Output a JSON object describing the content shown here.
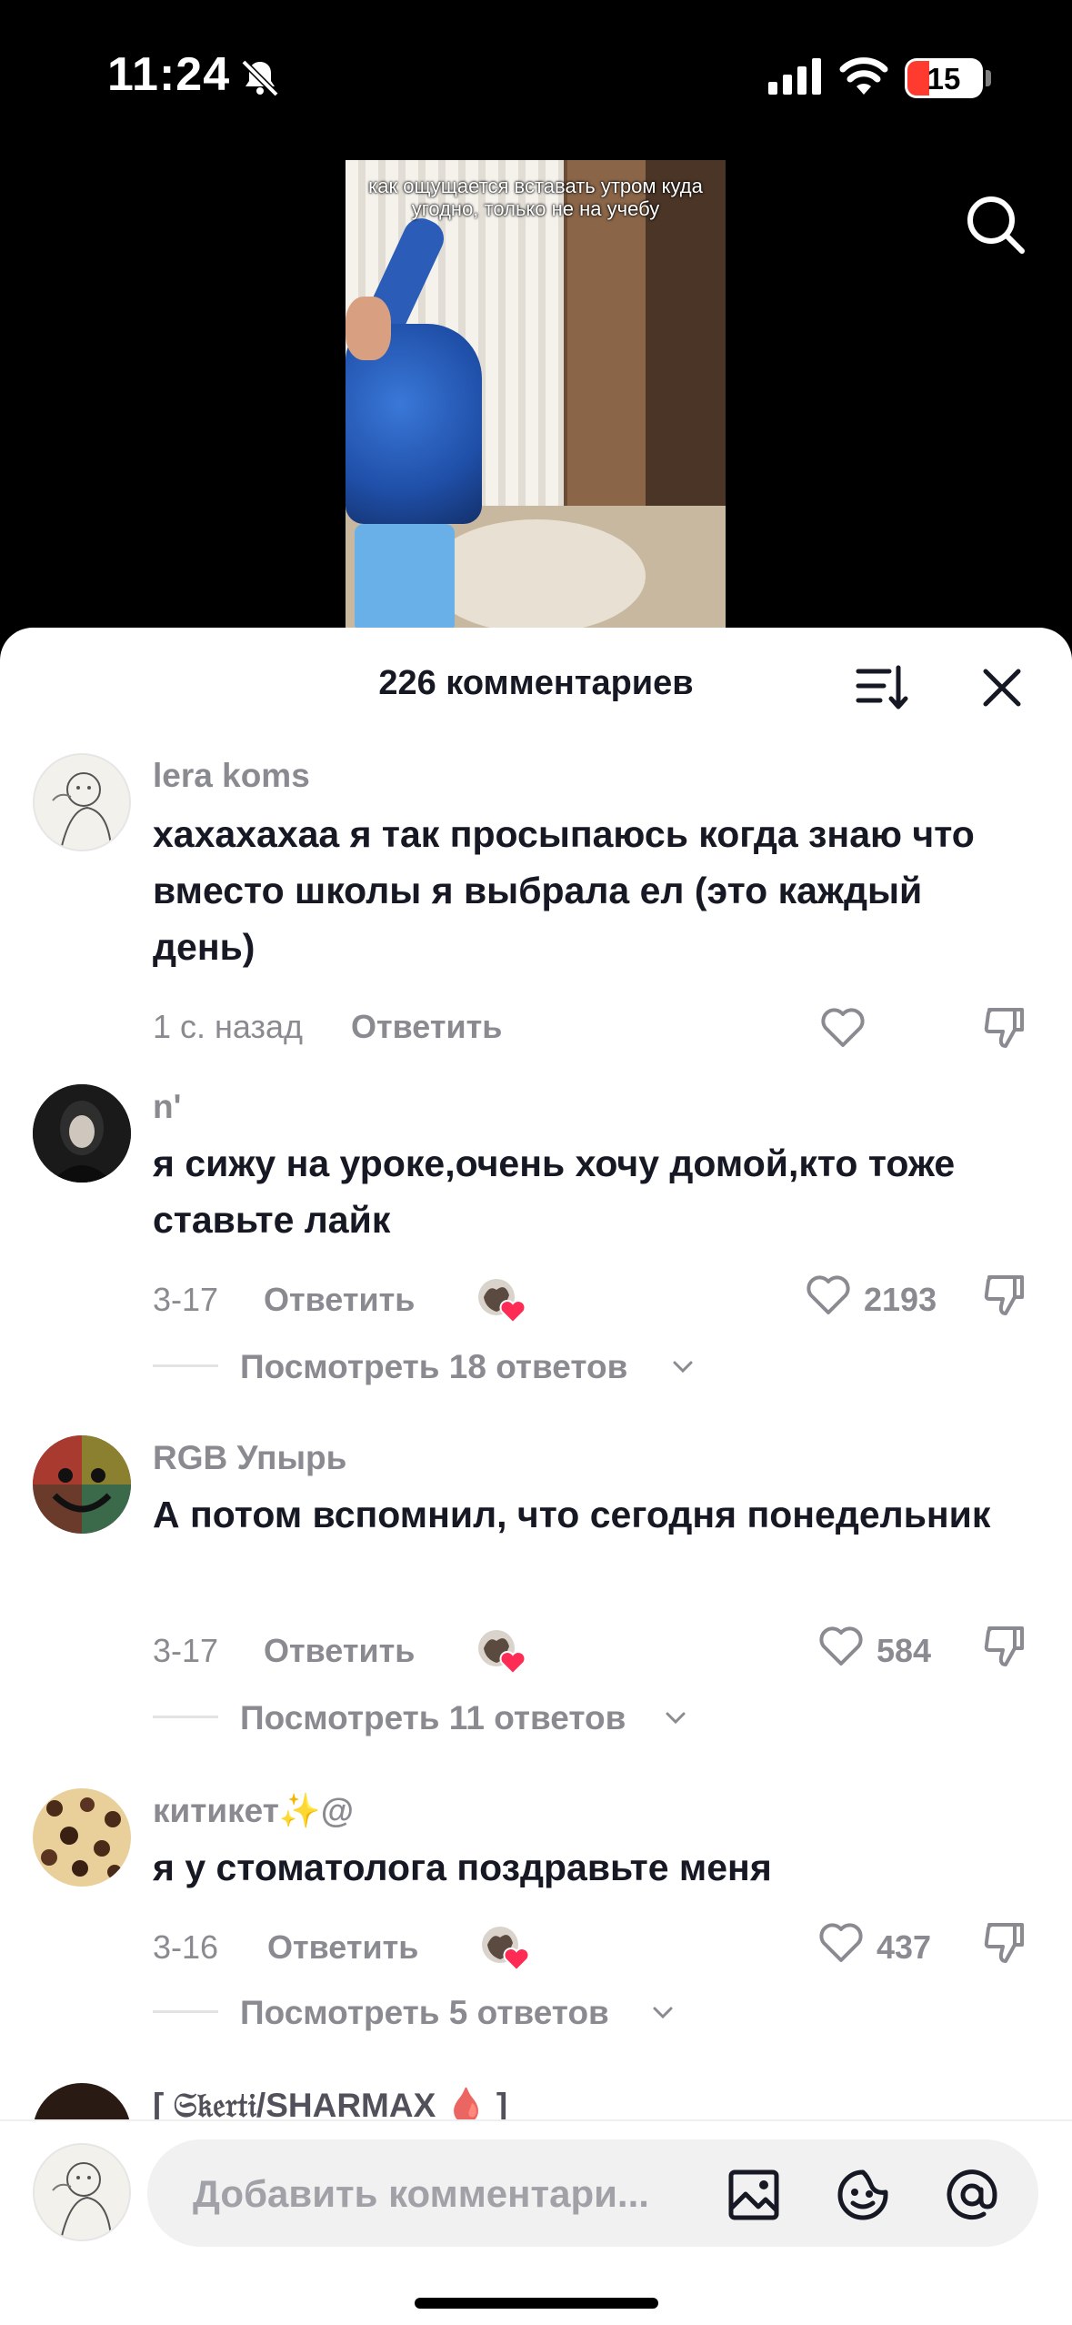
{
  "status_bar": {
    "time": "11:24",
    "battery_level": "15"
  },
  "video": {
    "caption": "как ощущается вставать утром куда угодно, только не на учебу"
  },
  "comments_panel": {
    "title": "226 комментариев"
  },
  "comments": [
    {
      "user": "lera koms",
      "text": "хахахахаа я так просыпаюсь когда знаю что вместо школы я выбрала ел (это каждый день)",
      "date": "1 с. назад",
      "reply_label": "Ответить",
      "likes": "",
      "liked_by_creator": false,
      "view_replies": ""
    },
    {
      "user": "n'",
      "text": "я сижу на уроке,очень хочу домой,кто тоже ставьте лайк",
      "date": "3-17",
      "reply_label": "Ответить",
      "likes": "2193",
      "liked_by_creator": true,
      "view_replies": "Посмотреть 18 ответов"
    },
    {
      "user": "RGB Упырь",
      "text": "А потом вспомнил, что сегодня понедельник",
      "date": "3-17",
      "reply_label": "Ответить",
      "likes": "584",
      "liked_by_creator": true,
      "view_replies": "Посмотреть 11 ответов"
    },
    {
      "user": "китикет✨@",
      "text": "я у стоматолога поздравьте меня",
      "date": "3-16",
      "reply_label": "Ответить",
      "likes": "437",
      "liked_by_creator": true,
      "view_replies": "Посмотреть 5 ответов"
    },
    {
      "user": "[ 𝔖𝔨𝔢𝔯𝔱𝔦/SHARMAX 🩸 ]",
      "text": "",
      "date": "",
      "reply_label": "",
      "likes": "",
      "liked_by_creator": false,
      "view_replies": ""
    }
  ],
  "input": {
    "placeholder": "Добавить комментари...",
    "icons": [
      "image-icon",
      "emoji-icon",
      "mention-icon"
    ]
  },
  "colors": {
    "text_primary": "#161823",
    "text_secondary": "#8a8b91",
    "creator_heart": "#fe2c55",
    "battery_low": "#ff3b30"
  }
}
